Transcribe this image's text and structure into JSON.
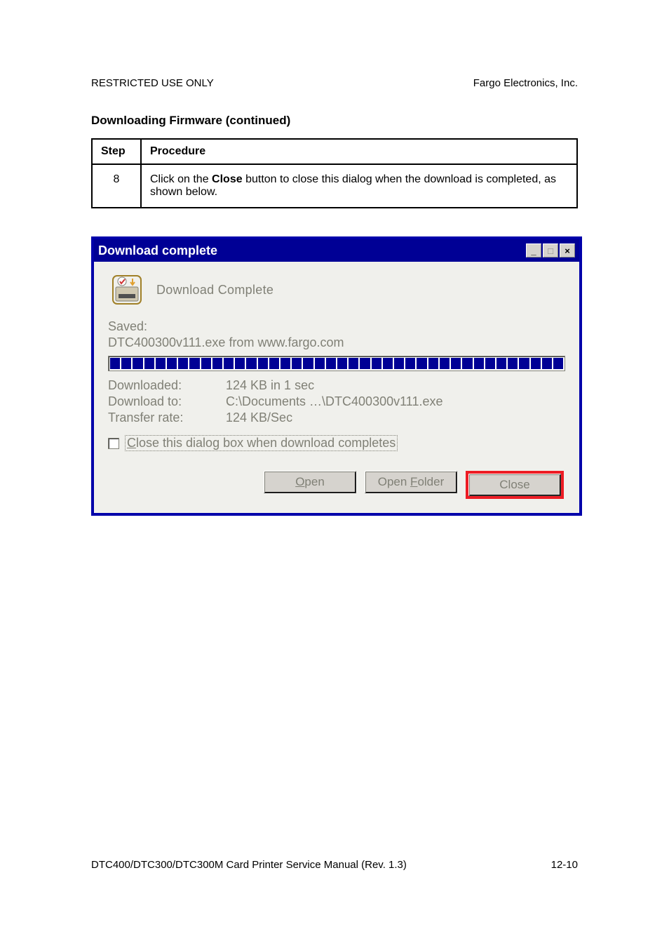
{
  "page": {
    "header_left": "RESTRICTED USE ONLY",
    "header_right": "Fargo Electronics, Inc.",
    "section_title": "Downloading Firmware (continued)",
    "footer_left": "DTC400/DTC300/DTC300M Card Printer Service Manual (Rev. 1.3)",
    "footer_right": "12-10"
  },
  "table": {
    "col1": "Step",
    "col2": "Procedure",
    "step_num": "8",
    "procedure_pre": "Click on the ",
    "procedure_bold": "Close",
    "procedure_post": " button to close this dialog when the download is completed, as shown below."
  },
  "dialog": {
    "title": "Download complete",
    "dl_complete": "Download Complete",
    "saved_label": "Saved:",
    "saved_path": "DTC400300v111.exe from www.fargo.com",
    "rows": {
      "downloaded_label": "Downloaded:",
      "downloaded_value": "124 KB in 1 sec",
      "download_to_label": "Download to:",
      "download_to_value": "C:\\Documents …\\DTC400300v111.exe",
      "transfer_label": "Transfer rate:",
      "transfer_value": "124 KB/Sec"
    },
    "checkbox_label_pre": "C",
    "checkbox_label_post": "lose this dialog box when download completes",
    "buttons": {
      "open_pre": "O",
      "open_post": "pen",
      "open_folder_pre": "Open ",
      "open_folder_u": "F",
      "open_folder_post": "older",
      "close": "Close"
    },
    "win_min": "_",
    "win_max": "□",
    "win_close": "×"
  }
}
